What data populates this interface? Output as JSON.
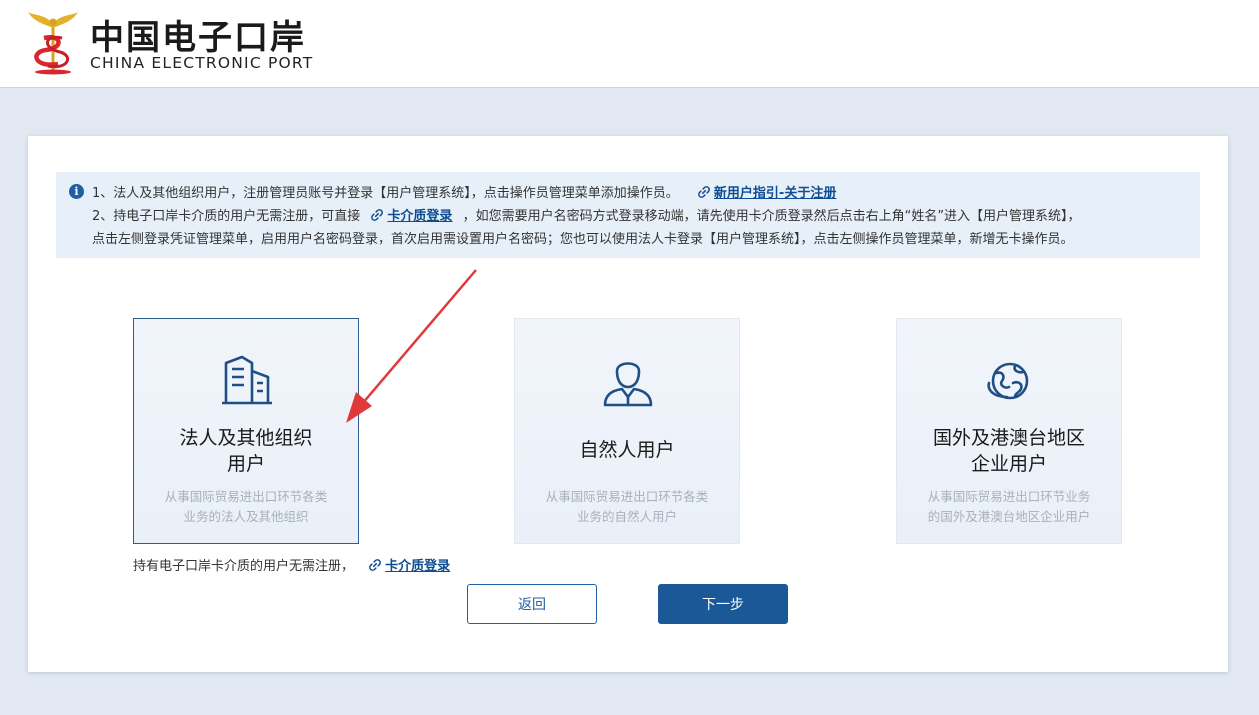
{
  "header": {
    "logo_cn": "中国电子口岸",
    "logo_en": "CHINA ELECTRONIC PORT"
  },
  "notice": {
    "line1_text": "1、法人及其他组织用户，注册管理员账号并登录【用户管理系统】，点击操作员管理菜单添加操作员。",
    "line1_link": "新用户指引-关于注册",
    "line2_prefix": "2、持电子口岸卡介质的用户无需注册，可直接",
    "line2_link": "卡介质登录",
    "line2_suffix": "，如您需要用户名密码方式登录移动端，请先使用卡介质登录然后点击右上角“姓名”进入【用户管理系统】，",
    "line3_text": "点击左侧登录凭证管理菜单，启用用户名密码登录，首次启用需设置用户名密码；您也可以使用法人卡登录【用户管理系统】，点击左侧操作员管理菜单，新增无卡操作员。"
  },
  "options": [
    {
      "title_line1": "法人及其他组织",
      "title_line2": "用户",
      "desc_line1": "从事国际贸易进出口环节各类",
      "desc_line2": "业务的法人及其他组织",
      "icon": "building-icon",
      "selected": true
    },
    {
      "title_line1": "自然人用户",
      "title_line2": "",
      "desc_line1": "从事国际贸易进出口环节各类",
      "desc_line2": "业务的自然人用户",
      "icon": "person-icon",
      "selected": false
    },
    {
      "title_line1": "国外及港澳台地区",
      "title_line2": "企业用户",
      "desc_line1": "从事国际贸易进出口环节业务",
      "desc_line2": "的国外及港澳台地区企业用户",
      "icon": "globe-icon",
      "selected": false
    }
  ],
  "hint": {
    "text": "持有电子口岸卡介质的用户无需注册，",
    "link": "卡介质登录"
  },
  "buttons": {
    "back": "返回",
    "next": "下一步"
  },
  "colors": {
    "accent": "#1a5898",
    "link": "#0f4d92",
    "annotation_arrow": "#e0393b"
  }
}
